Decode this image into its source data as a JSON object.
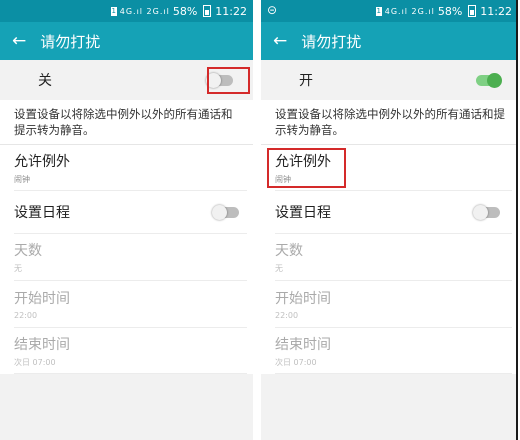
{
  "status": {
    "signal_text": "4G.ıl 2G.ıl",
    "battery": "58%",
    "time": "11:22",
    "sim_label": "1",
    "right_left_glyph": "⊝"
  },
  "left": {
    "title": "请勿打扰",
    "master_label": "关",
    "master_state": "off",
    "description": "设置设备以将除选中例外以外的所有通话和提示转为静音。",
    "exceptions": {
      "label": "允许例外",
      "value": "闹钟"
    },
    "schedule": {
      "label": "设置日程",
      "state": "off"
    },
    "days": {
      "label": "天数",
      "value": "无"
    },
    "start": {
      "label": "开始时间",
      "value": "22:00"
    },
    "end": {
      "label": "结束时间",
      "value": "次日 07:00"
    }
  },
  "right": {
    "title": "请勿打扰",
    "master_label": "开",
    "master_state": "on",
    "description": "设置设备以将除选中例外以外的所有通话和提示转为静音。",
    "exceptions": {
      "label": "允许例外",
      "value": "闹钟"
    },
    "schedule": {
      "label": "设置日程",
      "state": "off"
    },
    "days": {
      "label": "天数",
      "value": "无"
    },
    "start": {
      "label": "开始时间",
      "value": "22:00"
    },
    "end": {
      "label": "结束时间",
      "value": "次日 07:00"
    }
  },
  "icons": {
    "back": "arrow-left-icon"
  },
  "colors": {
    "statusbar": "#0b8fa4",
    "appbar": "#15a2b6",
    "highlight": "#d42a2a",
    "switch_on": "#4caf50"
  }
}
